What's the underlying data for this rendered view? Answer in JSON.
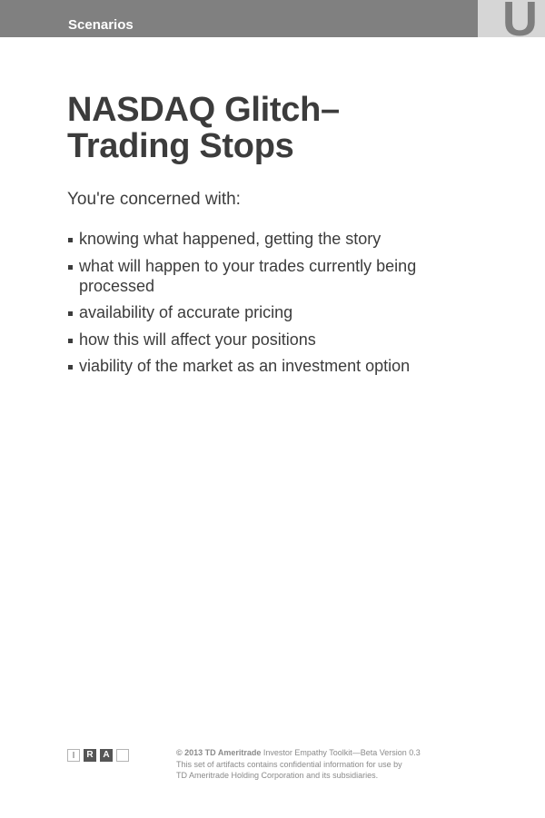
{
  "header": {
    "section_label": "Scenarios",
    "tab_letter": "U"
  },
  "main": {
    "title_line1": "NASDAQ Glitch–",
    "title_line2": "Trading Stops",
    "intro": "You're concerned with:",
    "concerns": [
      "knowing what happened, getting the story",
      "what will happen to your trades currently being processed",
      "availability of accurate pricing",
      "how this will affect your positions",
      "viability of the market as an investment option"
    ]
  },
  "footer": {
    "logo_letters": [
      "I",
      "R",
      "A",
      ""
    ],
    "copyright_brand": "© 2013 TD Ameritrade",
    "copyright_rest": " Investor Empathy Toolkit—Beta Version 0.3",
    "notice_line1": "This set of artifacts contains confidential information for use by",
    "notice_line2": "TD Ameritrade Holding Corporation and its subsidiaries."
  }
}
